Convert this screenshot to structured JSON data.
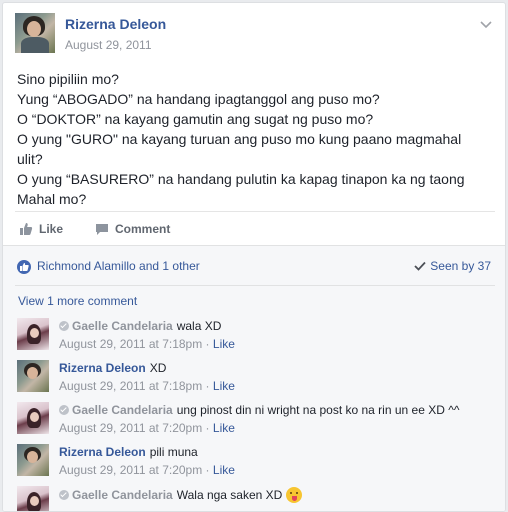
{
  "post": {
    "author": "Rizerna Deleon",
    "date": "August 29, 2011",
    "lines": [
      "Sino pipiliin mo?",
      "Yung “ABOGADO” na handang ipagtanggol ang puso mo?",
      "O “DOKTOR” na kayang gamutin ang sugat ng puso mo?",
      "O yung \"GURO\" na kayang turuan ang puso mo kung paano magmahal",
      "ulit?",
      "O yung “BASURERO” na handang pulutin ka kapag tinapon ka ng taong",
      "Mahal mo?"
    ]
  },
  "actions": {
    "like": "Like",
    "comment": "Comment"
  },
  "reactions": {
    "likers": "Richmond Alamillo and 1 other",
    "seen": "Seen by 37"
  },
  "view_more": "View 1 more comment",
  "comments": [
    {
      "author": "Gaelle Candelaria",
      "text": "wala XD",
      "time": "August 29, 2011 at 7:18pm",
      "like": "Like"
    },
    {
      "author": "Rizerna Deleon",
      "text": "XD",
      "time": "August 29, 2011 at 7:18pm",
      "like": "Like"
    },
    {
      "author": "Gaelle Candelaria",
      "text": "ung pinost din ni wright na post ko na rin un ee XD ^^",
      "time": "August 29, 2011 at 7:20pm",
      "like": "Like"
    },
    {
      "author": "Rizerna Deleon",
      "text": "pili muna",
      "time": "August 29, 2011 at 7:20pm",
      "like": "Like"
    },
    {
      "author": "Gaelle Candelaria",
      "text": "Wala nga saken XD",
      "time": "",
      "like": ""
    }
  ],
  "colors": {
    "link": "#365899",
    "meta": "#90949c",
    "like_badge": "#4267b2"
  }
}
